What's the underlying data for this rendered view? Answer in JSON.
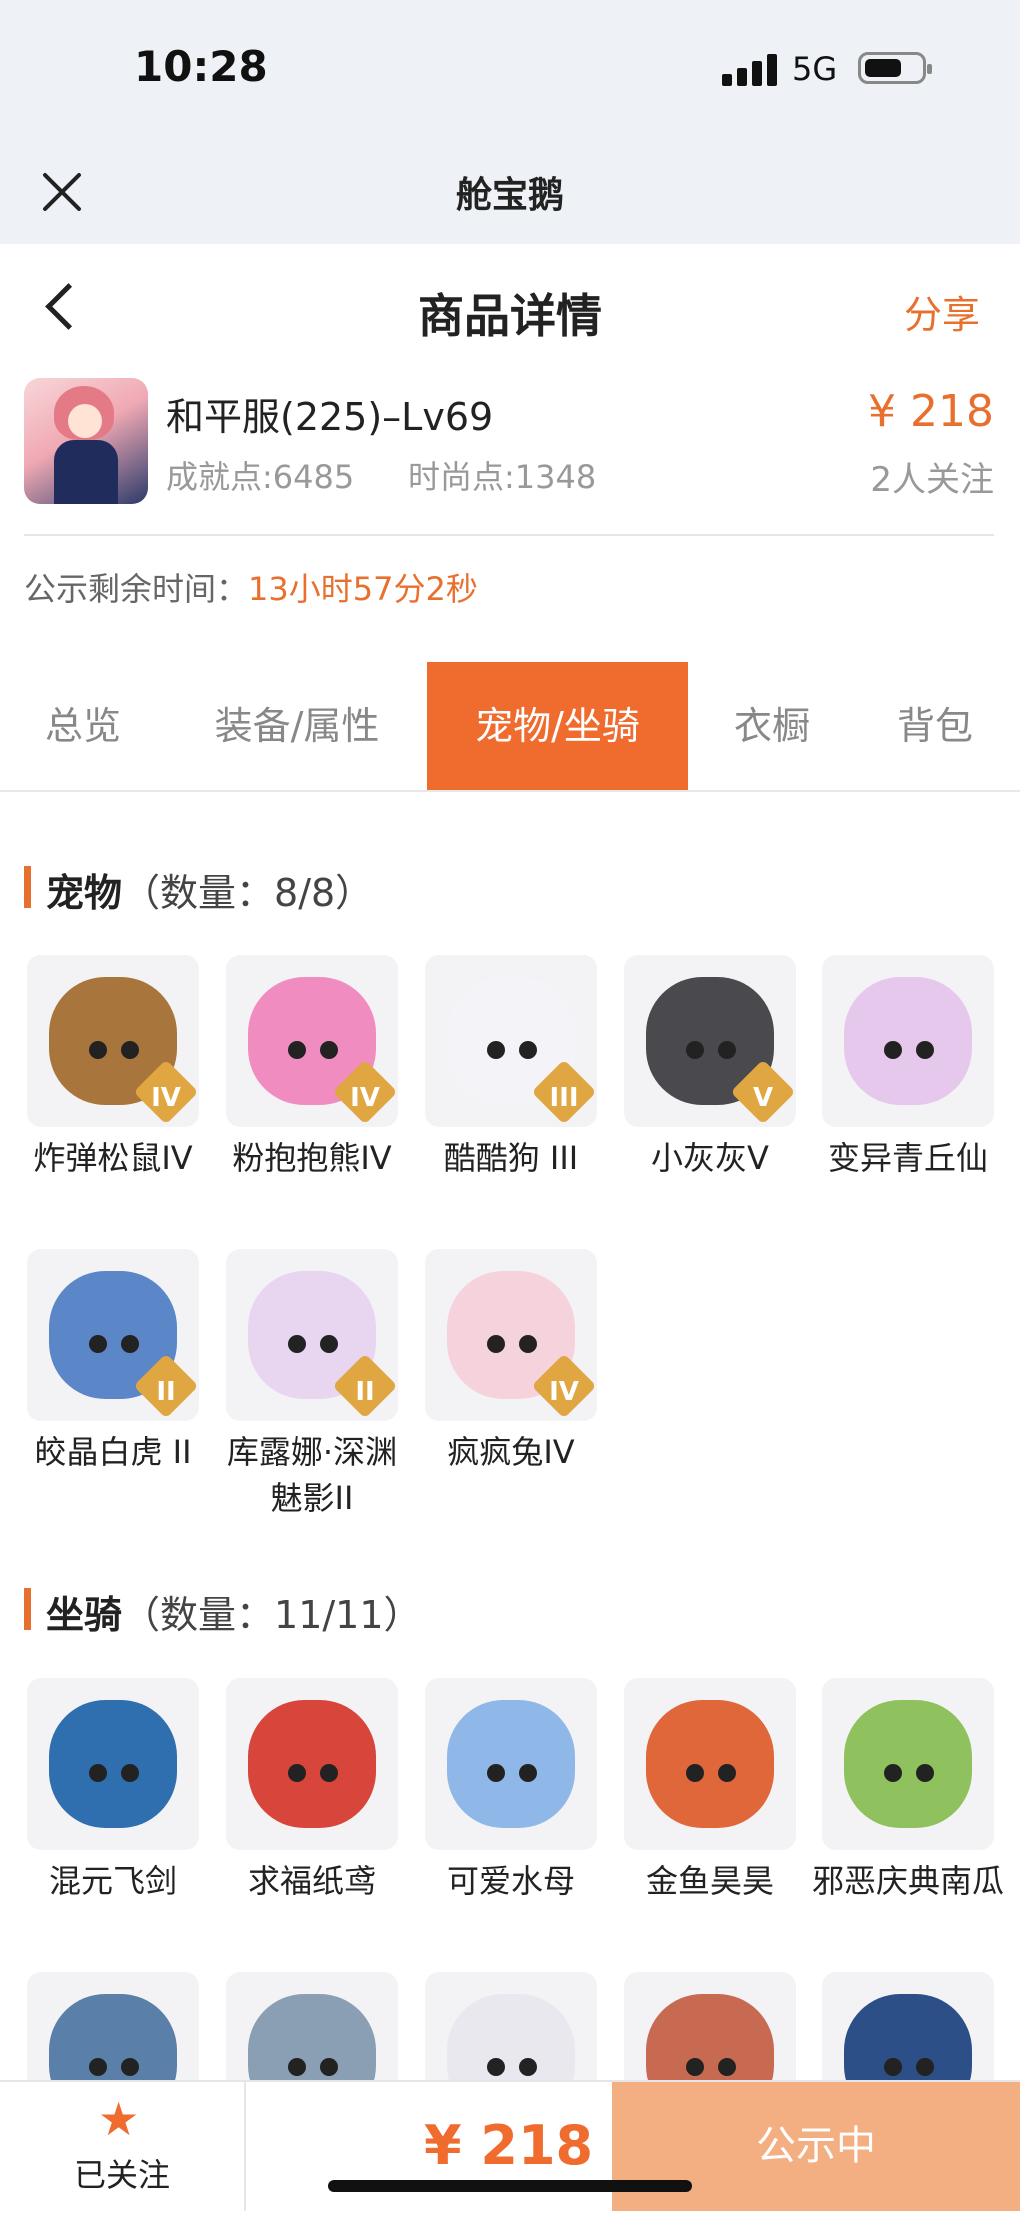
{
  "status_bar": {
    "time": "10:28",
    "network": "5G"
  },
  "mini_header": {
    "title": "舱宝鹅"
  },
  "page_header": {
    "title": "商品详情",
    "share": "分享"
  },
  "product": {
    "name": "和平服(225)–Lv69",
    "achievement": "成就点:6485",
    "fashion": "时尚点:1348",
    "price": "¥ 218",
    "watchers": "2人关注"
  },
  "countdown": {
    "label": "公示剩余时间：",
    "value": "13小时57分2秒"
  },
  "tabs": [
    "总览",
    "装备/属性",
    "宠物/坐骑",
    "衣橱",
    "背包"
  ],
  "active_tab": "宠物/坐骑",
  "pets": {
    "title": "宠物",
    "count": "（数量：8/8）",
    "items": [
      {
        "name": "炸弹松鼠IV",
        "rank": "IV",
        "color": "#a8763c"
      },
      {
        "name": "粉抱抱熊IV",
        "rank": "IV",
        "color": "#f08cc0"
      },
      {
        "name": "酷酷狗 III",
        "rank": "III",
        "color": "#f4f4f8"
      },
      {
        "name": "小灰灰V",
        "rank": "V",
        "color": "#4a4a4e"
      },
      {
        "name": "变异青丘仙",
        "rank": "",
        "color": "#e6c8ec"
      },
      {
        "name": "皎晶白虎 II",
        "rank": "II",
        "color": "#5b86c8"
      },
      {
        "name": "库露娜·深渊魅影II",
        "rank": "II",
        "color": "#e8d6f0"
      },
      {
        "name": "疯疯兔IV",
        "rank": "IV",
        "color": "#f6d3dc"
      }
    ]
  },
  "mounts": {
    "title": "坐骑",
    "count": "（数量：11/11）",
    "items": [
      {
        "name": "混元飞剑",
        "color": "#2f6fb0"
      },
      {
        "name": "求福纸鸢",
        "color": "#d8453a"
      },
      {
        "name": "可爱水母",
        "color": "#8fb8e8"
      },
      {
        "name": "金鱼昊昊",
        "color": "#e0673a"
      },
      {
        "name": "邪恶庆典南瓜",
        "color": "#8fc25e"
      },
      {
        "name": "",
        "color": "#5a7fa8"
      },
      {
        "name": "",
        "color": "#8a9fb4"
      },
      {
        "name": "",
        "color": "#e8e8ee"
      },
      {
        "name": "",
        "color": "#c86a52"
      },
      {
        "name": "",
        "color": "#2b4f86"
      }
    ]
  },
  "bottom_bar": {
    "fav_label": "已关注",
    "price": "¥ 218",
    "status": "公示中"
  }
}
